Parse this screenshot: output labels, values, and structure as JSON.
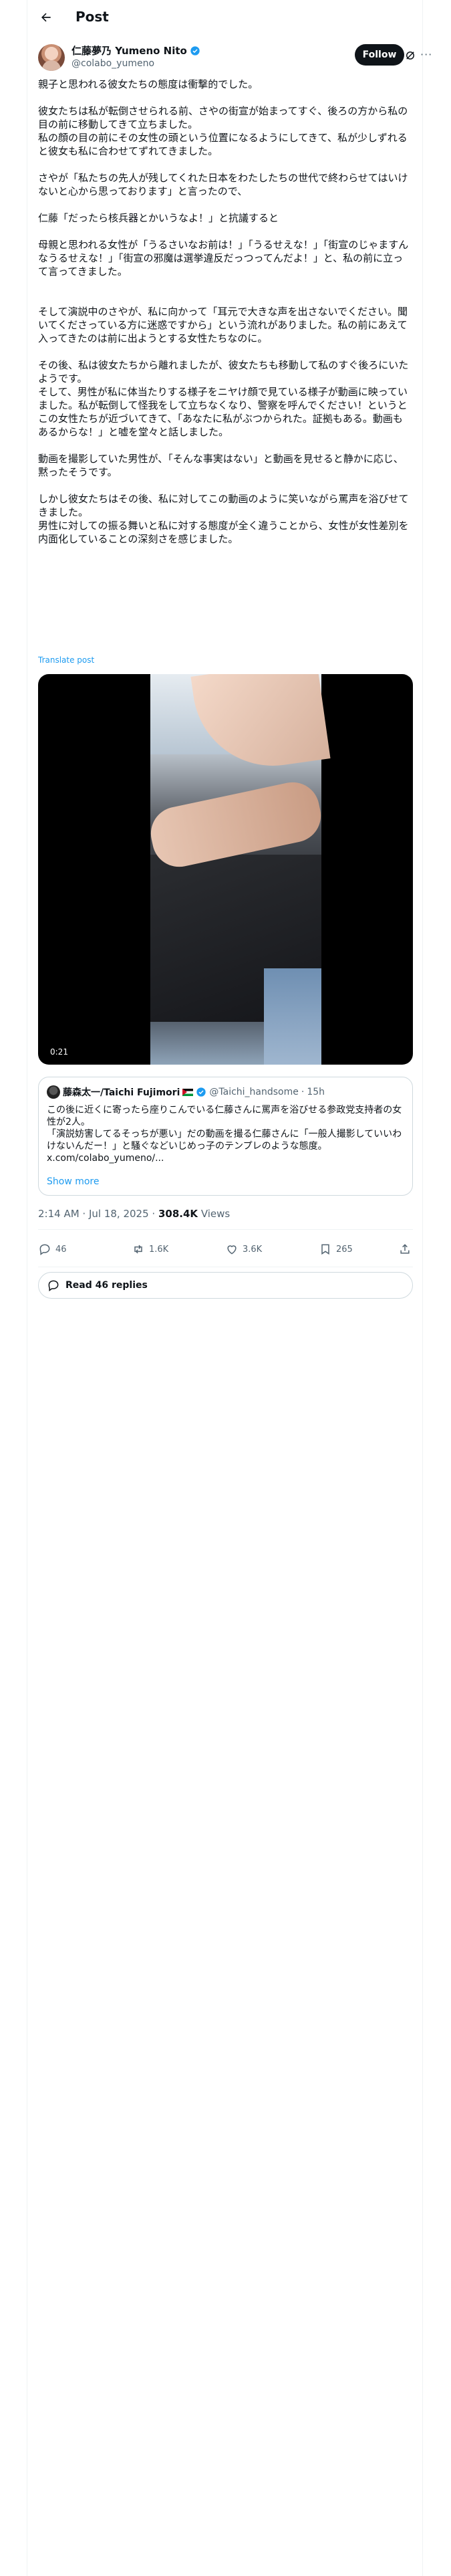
{
  "header": {
    "title": "Post"
  },
  "author": {
    "display_name": "仁藤夢乃 Yumeno Nito",
    "handle": "@colabo_yumeno",
    "follow_label": "Follow"
  },
  "post": {
    "text": "親子と思われる彼女たちの態度は衝撃的でした。\n\n彼女たちは私が転倒させられる前、さやの街宣が始まってすぐ、後ろの方から私の目の前に移動してきて立ちました。\n私の顔の目の前にその女性の頭という位置になるようにしてきて、私が少しずれると彼女も私に合わせてずれてきました。\n\nさやが「私たちの先人が残してくれた日本をわたしたちの世代で終わらせてはいけないと心から思っております」と言ったので、\n\n仁藤「だったら核兵器とかいうなよ！」と抗議すると\n\n母親と思われる女性が「うるさいなお前は！」「うるせえな！」「街宣のじゃますんなうるせえな！」「街宣の邪魔は選挙違反だっつってんだよ！」と、私の前に立って言ってきました。\n\n\nそして演説中のさやが、私に向かって「耳元で大きな声を出さないでください。聞いてくださっている方に迷惑ですから」という流れがありました。私の前にあえて入ってきたのは前に出ようとする女性たちなのに。\n\nその後、私は彼女たちから離れましたが、彼女たちも移動して私のすぐ後ろにいたようです。\nそして、男性が私に体当たりする様子をニヤけ顔で見ている様子が動画に映っていました。私が転倒して怪我をして立ちなくなり、警察を呼んでください！というとこの女性たちが近づいてきて、「あなたに私がぶつかられた。証拠もある。動画もあるからな！」と嘘を堂々と話しました。\n\n動画を撮影していた男性が、「そんな事実はない」と動画を見せると静かに応じ、黙ったそうです。\n\nしかし彼女たちはその後、私に対してこの動画のように笑いながら罵声を浴びせてきました。\n男性に対しての振る舞いと私に対する態度が全く違うことから、女性が女性差別を内面化していることの深刻さを感じました。",
    "translate_label": "Translate post",
    "video_time": "0:21",
    "timestamp": "2:14 AM · Jul 18, 2025",
    "views_count": "308.4K",
    "views_label": "Views"
  },
  "quote": {
    "name": "藤森太一/Taichi Fujimori",
    "handle": "@Taichi_handsome",
    "time": "15h",
    "text": "この後に近くに寄ったら座りこんでいる仁藤さんに罵声を浴びせる参政党支持者の女性が2人。\n「演説妨害してるそっちが悪い」だの動画を撮る仁藤さんに「一般人撮影していいわけないんだー！」と騒ぐなどいじめっ子のテンプレのような態度。\nx.com/colabo_yumeno/...",
    "show_more": "Show more"
  },
  "actions": {
    "replies": "46",
    "reposts": "1.6K",
    "likes": "3.6K",
    "bookmarks": "265"
  },
  "read_replies": "Read 46 replies",
  "colors": {
    "accent": "#1d9bf0",
    "text": "#0f1419",
    "muted": "#536471"
  }
}
